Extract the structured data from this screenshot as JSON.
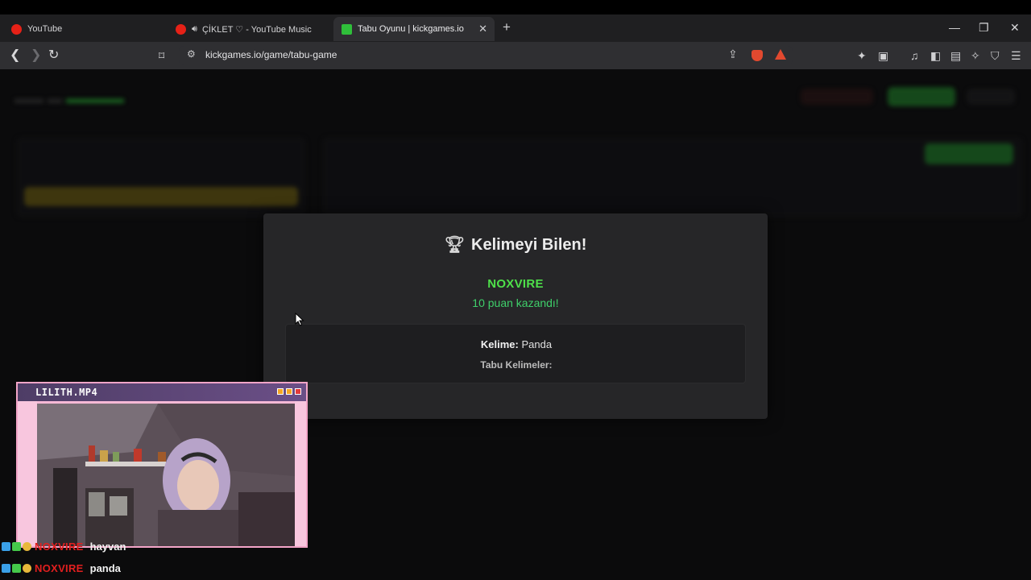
{
  "browser": {
    "tabs": [
      {
        "label": "YouTube",
        "favicon_color": "#e62117"
      },
      {
        "label": "ÇİKLET ♡ - YouTube Music",
        "favicon_color": "#e62117"
      },
      {
        "label": "Tabu Oyunu | kickgames.io",
        "favicon_color": "#2fbf3a"
      }
    ],
    "new_tab": "+",
    "tab_close": "✕",
    "url": "kickgames.io/game/tabu-game",
    "window_controls": {
      "minimize": "—",
      "maximize": "❐",
      "close": "✕"
    }
  },
  "modal": {
    "title": "Kelimeyi Bilen!",
    "winner": "NOXVIRE",
    "points_text": "10 puan kazandı!",
    "word_label": "Kelime:",
    "word_value": "Panda",
    "taboo_label": "Tabu Kelimeler:"
  },
  "webcam": {
    "title": "LILITH.MP4"
  },
  "chat": [
    {
      "user": "NOXVIRE",
      "message": "hayvan"
    },
    {
      "user": "NOXVIRE",
      "message": "panda"
    }
  ],
  "colors": {
    "accent_green": "#4ee04a",
    "points_green": "#3fcf6a",
    "chat_user_red": "#e21f1f"
  }
}
